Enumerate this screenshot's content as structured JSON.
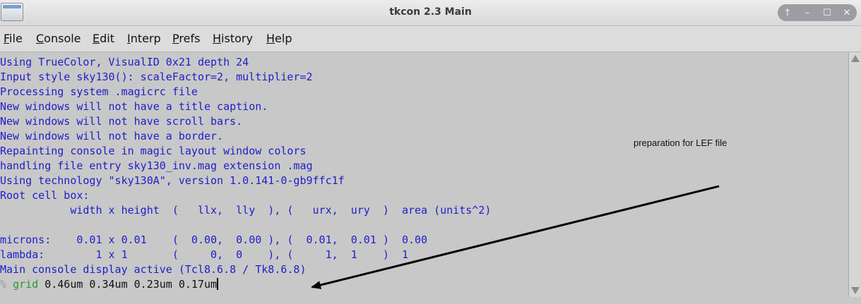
{
  "window": {
    "title": "tkcon 2.3 Main"
  },
  "window_controls": [
    "↑",
    "–",
    "☐",
    "✕"
  ],
  "menu": {
    "items": [
      {
        "u": "F",
        "rest": "ile"
      },
      {
        "u": "C",
        "rest": "onsole"
      },
      {
        "u": "E",
        "rest": "dit"
      },
      {
        "u": "I",
        "rest": "nterp"
      },
      {
        "u": "P",
        "rest": "refs"
      },
      {
        "u": "H",
        "rest": "istory"
      },
      {
        "u": "H",
        "rest": "elp"
      }
    ]
  },
  "console": {
    "lines": [
      "Using TrueColor, VisualID 0x21 depth 24",
      "Input style sky130(): scaleFactor=2, multiplier=2",
      "Processing system .magicrc file",
      "New windows will not have a title caption.",
      "New windows will not have scroll bars.",
      "New windows will not have a border.",
      "Repainting console in magic layout window colors",
      "handling file entry sky130_inv.mag extension .mag",
      "Using technology \"sky130A\", version 1.0.141-0-gb9ffc1f",
      "Root cell box:",
      "           width x height  (   llx,  lly  ), (   urx,  ury  )  area (units^2)",
      "",
      "microns:    0.01 x 0.01    (  0.00,  0.00 ), (  0.01,  0.01 )  0.00",
      "lambda:        1 x 1       (     0,  0    ), (     1,  1    )  1",
      "Main console display active (Tcl8.6.8 / Tk8.6.8)"
    ],
    "prompt": {
      "symbol": "%",
      "command": "grid",
      "args": " 0.46um 0.34um 0.23um 0.17um"
    }
  },
  "annotation": {
    "text": "preparation for LEF file"
  }
}
